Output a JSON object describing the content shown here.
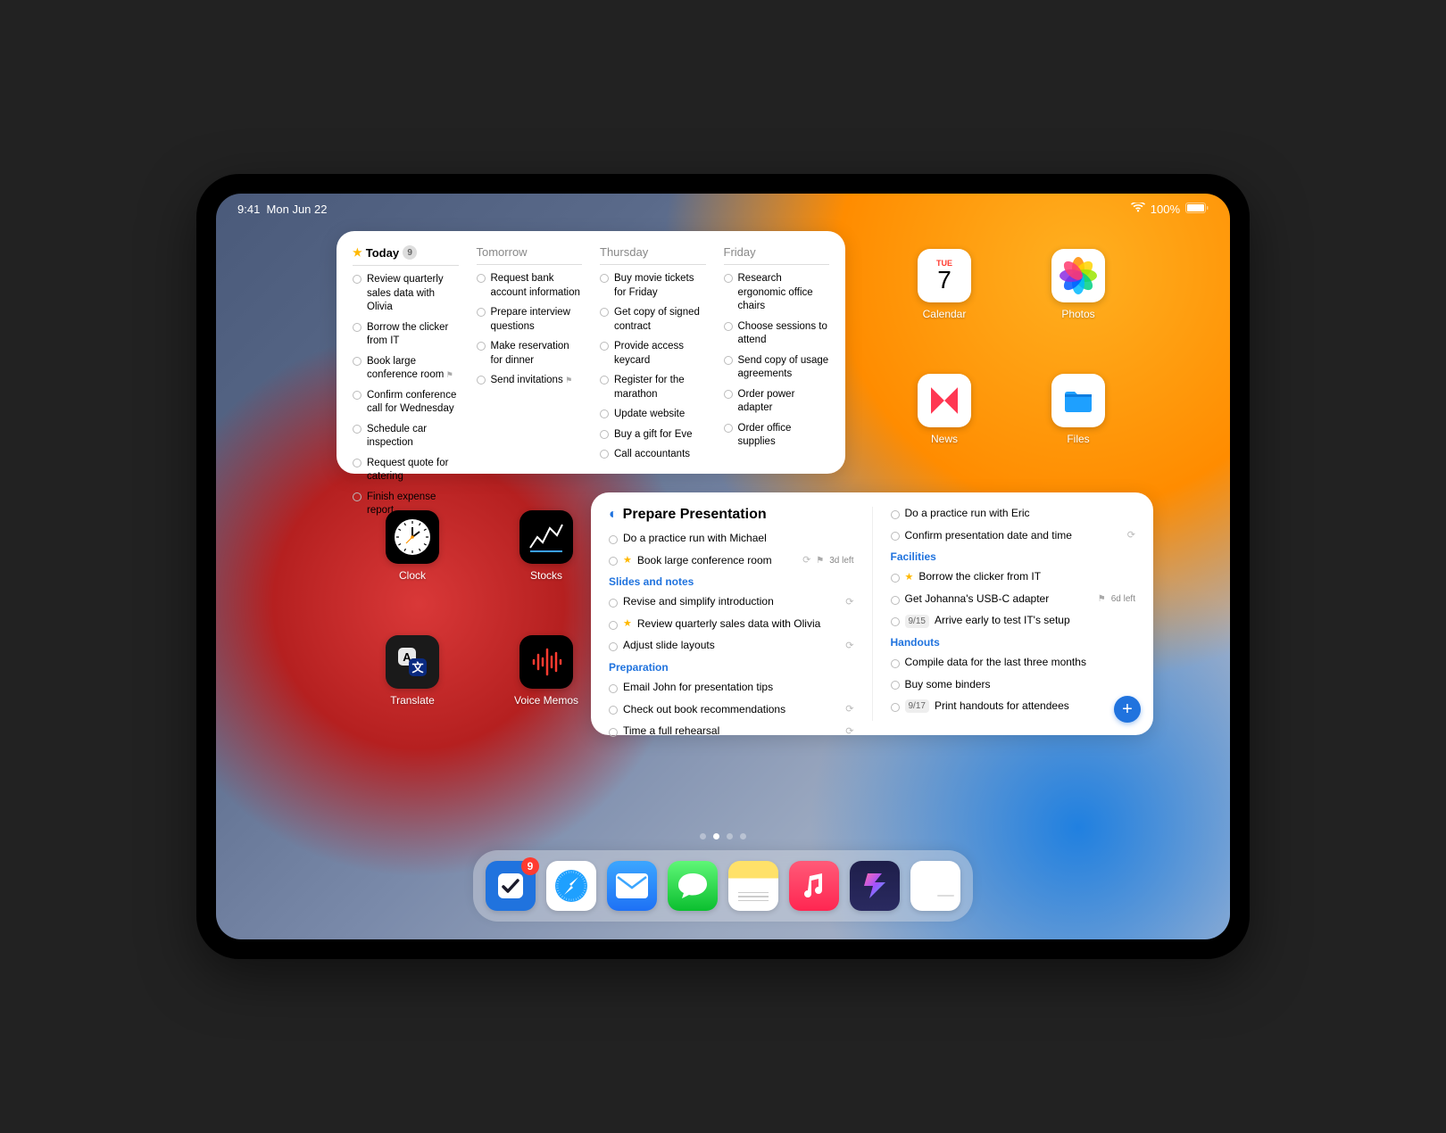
{
  "status": {
    "time": "9:41",
    "date": "Mon Jun 22",
    "wifi": true,
    "battery_pct": "100%"
  },
  "forecast": {
    "columns": [
      {
        "title": "Today",
        "starred": true,
        "count": "9",
        "tasks": [
          {
            "text": "Review quarterly sales data with Olivia"
          },
          {
            "text": "Borrow the clicker from IT"
          },
          {
            "text": "Book large conference room",
            "flag": true
          },
          {
            "text": "Confirm conference call for Wednesday"
          },
          {
            "text": "Schedule car inspection"
          },
          {
            "text": "Request quote for catering"
          },
          {
            "text": "Finish expense report"
          }
        ]
      },
      {
        "title": "Tomorrow",
        "tasks": [
          {
            "text": "Request bank account information"
          },
          {
            "text": "Prepare interview questions"
          },
          {
            "text": "Make reservation for dinner"
          },
          {
            "text": "Send invitations",
            "flag": true
          }
        ]
      },
      {
        "title": "Thursday",
        "tasks": [
          {
            "text": "Buy movie tickets for Friday"
          },
          {
            "text": "Get copy of signed contract"
          },
          {
            "text": "Provide access keycard"
          },
          {
            "text": "Register for the marathon"
          },
          {
            "text": "Update website"
          },
          {
            "text": "Buy a gift for Eve"
          },
          {
            "text": "Call accountants"
          }
        ]
      },
      {
        "title": "Friday",
        "tasks": [
          {
            "text": "Research ergonomic office chairs"
          },
          {
            "text": "Choose sessions to attend"
          },
          {
            "text": "Send copy of usage agreements"
          },
          {
            "text": "Order power adapter"
          },
          {
            "text": "Order office supplies"
          }
        ]
      }
    ]
  },
  "apps_top": [
    {
      "name": "Calendar",
      "icon": "calendar",
      "day_name": "TUE",
      "day_num": "7"
    },
    {
      "name": "Photos",
      "icon": "photos"
    },
    {
      "name": "News",
      "icon": "news"
    },
    {
      "name": "Files",
      "icon": "files"
    }
  ],
  "apps_mid": [
    {
      "name": "Clock",
      "icon": "clock"
    },
    {
      "name": "Stocks",
      "icon": "stocks"
    },
    {
      "name": "Translate",
      "icon": "translate"
    },
    {
      "name": "Voice Memos",
      "icon": "voice"
    }
  ],
  "project": {
    "title": "Prepare Presentation",
    "left": [
      {
        "type": "task",
        "text": "Do a practice run with Michael"
      },
      {
        "type": "task",
        "text": "Book large conference room",
        "star": true,
        "repeat": true,
        "flag": true,
        "due": "3d left"
      },
      {
        "type": "heading",
        "text": "Slides and notes"
      },
      {
        "type": "task",
        "text": "Revise and simplify introduction",
        "repeat": true
      },
      {
        "type": "task",
        "text": "Review quarterly sales data with Olivia",
        "star": true
      },
      {
        "type": "task",
        "text": "Adjust slide layouts",
        "repeat": true
      },
      {
        "type": "heading",
        "text": "Preparation"
      },
      {
        "type": "task",
        "text": "Email John for presentation tips"
      },
      {
        "type": "task",
        "text": "Check out book recommendations",
        "repeat": true
      },
      {
        "type": "task",
        "text": "Time a full rehearsal",
        "repeat": true
      }
    ],
    "right": [
      {
        "type": "task",
        "text": "Do a practice run with Eric"
      },
      {
        "type": "task",
        "text": "Confirm presentation date and time",
        "repeat": true
      },
      {
        "type": "heading",
        "text": "Facilities"
      },
      {
        "type": "task",
        "text": "Borrow the clicker from IT",
        "star": true
      },
      {
        "type": "task",
        "text": "Get Johanna's USB-C adapter",
        "flag": true,
        "due": "6d left"
      },
      {
        "type": "task",
        "text": "Arrive early to test IT's setup",
        "date": "9/15"
      },
      {
        "type": "heading",
        "text": "Handouts"
      },
      {
        "type": "task",
        "text": "Compile data for the last three months"
      },
      {
        "type": "task",
        "text": "Buy some binders"
      },
      {
        "type": "task",
        "text": "Print handouts for attendees",
        "date": "9/17"
      }
    ]
  },
  "page_dots": {
    "count": 4,
    "active": 1
  },
  "dock": [
    {
      "name": "Things",
      "icon": "things",
      "badge": "9"
    },
    {
      "name": "Safari",
      "icon": "safari"
    },
    {
      "name": "Mail",
      "icon": "mail"
    },
    {
      "name": "Messages",
      "icon": "msg"
    },
    {
      "name": "Notes",
      "icon": "notes"
    },
    {
      "name": "Music",
      "icon": "music"
    },
    {
      "name": "Shortcuts",
      "icon": "shortcuts"
    },
    {
      "name": "App Folder",
      "icon": "folder"
    }
  ]
}
